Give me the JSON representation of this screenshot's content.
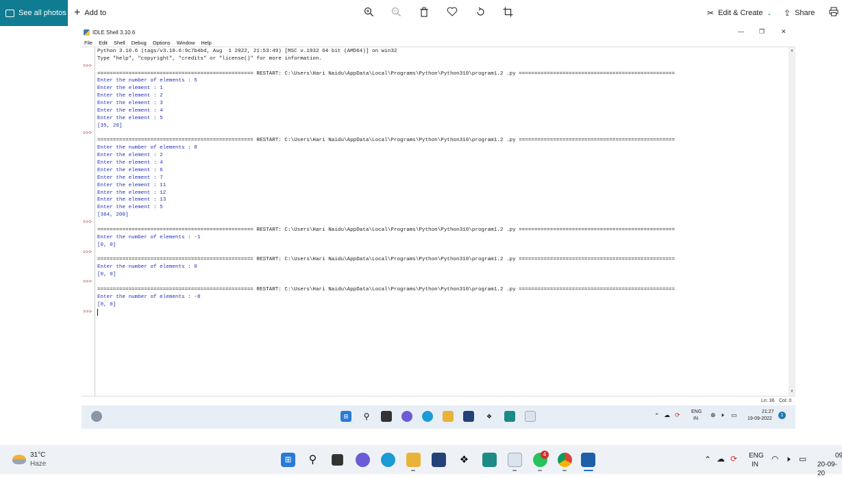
{
  "photos_toolbar": {
    "see_all": "See all photos",
    "add_to": "Add to",
    "edit_create": "Edit & Create",
    "share": "Share"
  },
  "idle": {
    "title": "IDLE Shell 3.10.6",
    "menu": [
      "File",
      "Edit",
      "Shell",
      "Debug",
      "Options",
      "Window",
      "Help"
    ],
    "prompt": ">>>",
    "lines": [
      {
        "t": "Python 3.10.6 (tags/v3.10.6:9c7b4bd, Aug  1 2022, 21:53:49) [MSC v.1932 64 bit (AMD64)] on win32",
        "k": "out"
      },
      {
        "t": "Type \"help\", \"copyright\", \"credits\" or \"license()\" for more information.",
        "k": "out"
      },
      {
        "t": "",
        "k": "out"
      },
      {
        "t": "================================================== RESTART: C:\\Users\\Hari Naidu\\AppData\\Local\\Programs\\Python\\Python310\\program1.2 .py ==================================================",
        "k": "out"
      },
      {
        "t": "Enter the number of elements : 5",
        "k": "in"
      },
      {
        "t": "Enter the element : 1",
        "k": "in"
      },
      {
        "t": "Enter the element : 2",
        "k": "in"
      },
      {
        "t": "Enter the element : 3",
        "k": "in"
      },
      {
        "t": "Enter the element : 4",
        "k": "in"
      },
      {
        "t": "Enter the element : 5",
        "k": "in"
      },
      {
        "t": "[35, 20]",
        "k": "in"
      },
      {
        "t": "",
        "k": "out"
      },
      {
        "t": "================================================== RESTART: C:\\Users\\Hari Naidu\\AppData\\Local\\Programs\\Python\\Python310\\program1.2 .py ==================================================",
        "k": "out"
      },
      {
        "t": "Enter the number of elements : 8",
        "k": "in"
      },
      {
        "t": "Enter the element : 2",
        "k": "in"
      },
      {
        "t": "Enter the element : 4",
        "k": "in"
      },
      {
        "t": "Enter the element : 6",
        "k": "in"
      },
      {
        "t": "Enter the element : 7",
        "k": "in"
      },
      {
        "t": "Enter the element : 11",
        "k": "in"
      },
      {
        "t": "Enter the element : 12",
        "k": "in"
      },
      {
        "t": "Enter the element : 13",
        "k": "in"
      },
      {
        "t": "Enter the element : 5",
        "k": "in"
      },
      {
        "t": "[364, 200]",
        "k": "in"
      },
      {
        "t": "",
        "k": "out"
      },
      {
        "t": "================================================== RESTART: C:\\Users\\Hari Naidu\\AppData\\Local\\Programs\\Python\\Python310\\program1.2 .py ==================================================",
        "k": "out"
      },
      {
        "t": "Enter the number of elements : -1",
        "k": "in"
      },
      {
        "t": "[0, 0]",
        "k": "in"
      },
      {
        "t": "",
        "k": "out"
      },
      {
        "t": "================================================== RESTART: C:\\Users\\Hari Naidu\\AppData\\Local\\Programs\\Python\\Python310\\program1.2 .py ==================================================",
        "k": "out"
      },
      {
        "t": "Enter the number of elements : 0",
        "k": "in"
      },
      {
        "t": "[0, 0]",
        "k": "in"
      },
      {
        "t": "",
        "k": "out"
      },
      {
        "t": "================================================== RESTART: C:\\Users\\Hari Naidu\\AppData\\Local\\Programs\\Python\\Python310\\program1.2 .py ==================================================",
        "k": "out"
      },
      {
        "t": "Enter the number of elements : -8",
        "k": "in"
      },
      {
        "t": "[0, 0]",
        "k": "in"
      }
    ],
    "status_ln": "Ln: 36",
    "status_col": "Col: 0"
  },
  "inner_tray": {
    "lang": "ENG",
    "region": "IN",
    "time": "21:27",
    "date": "19-09-2022",
    "notif": "1"
  },
  "taskbar": {
    "temp": "31°C",
    "weather": "Haze",
    "whatsapp_badge": "4",
    "lang": "ENG",
    "region": "IN",
    "time": "09",
    "date": "20-09-20"
  }
}
